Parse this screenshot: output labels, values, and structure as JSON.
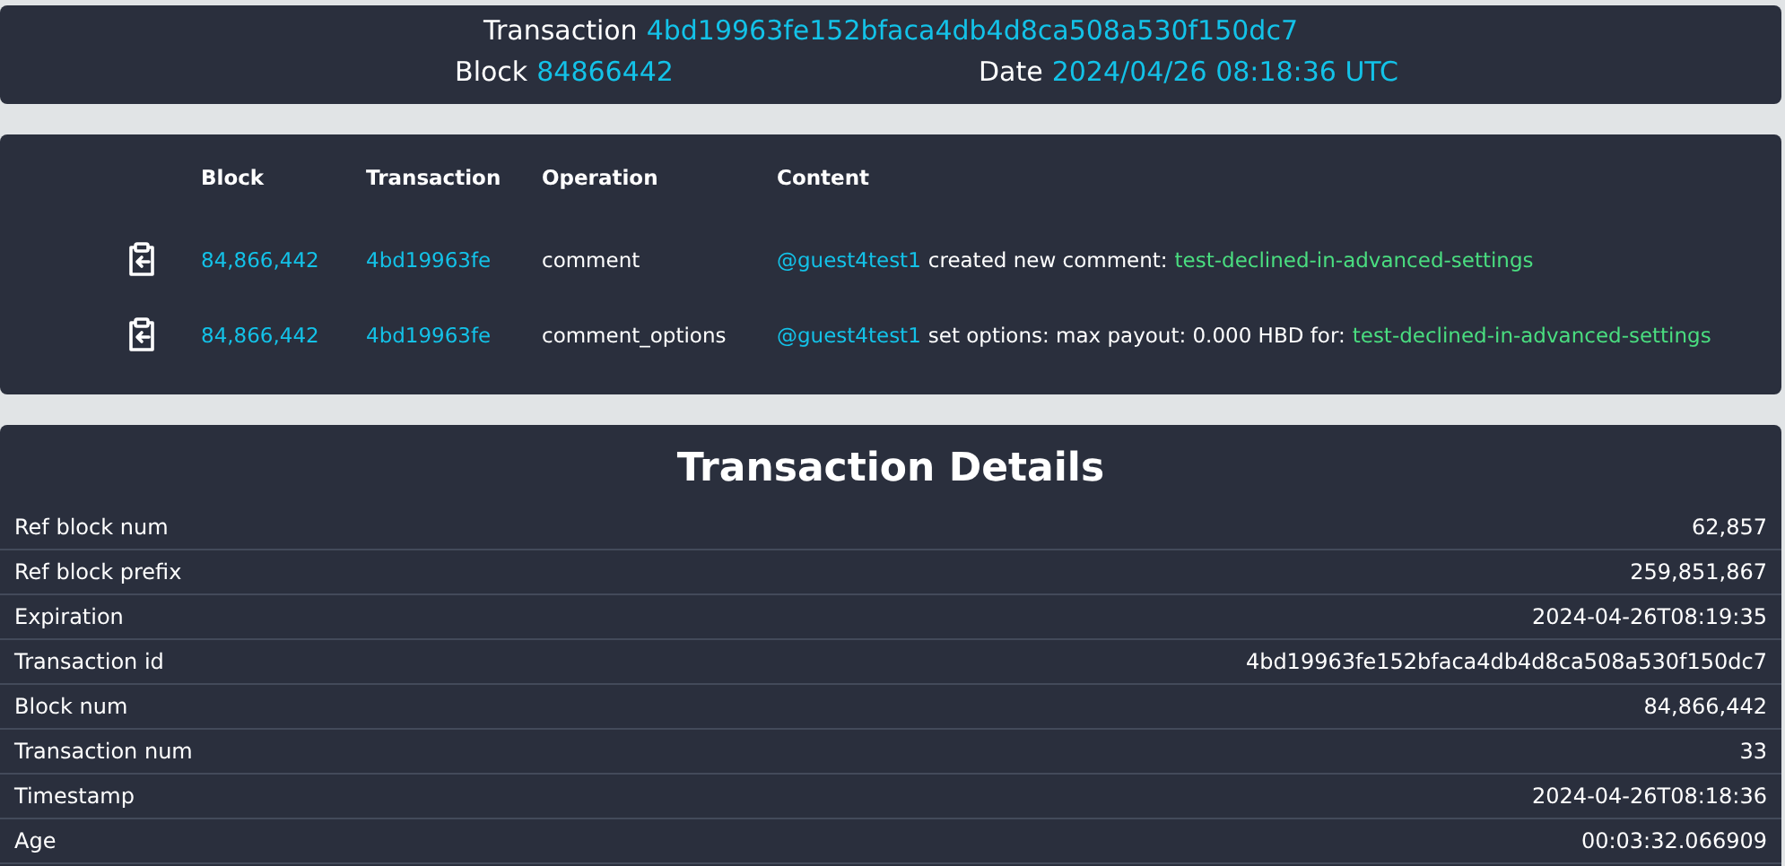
{
  "header": {
    "transaction_label": "Transaction",
    "transaction_id": "4bd19963fe152bfaca4db4d8ca508a530f150dc7",
    "block_label": "Block",
    "block": "84866442",
    "date_label": "Date",
    "date": "2024/04/26 08:18:36 UTC"
  },
  "operations": {
    "columns": [
      "Block",
      "Transaction",
      "Operation",
      "Content"
    ],
    "rows": [
      {
        "block": "84,866,442",
        "transaction": "4bd19963fe",
        "operation": "comment",
        "account": "@guest4test1",
        "text": "created new comment:",
        "permlink": "test-declined-in-advanced-settings"
      },
      {
        "block": "84,866,442",
        "transaction": "4bd19963fe",
        "operation": "comment_options",
        "account": "@guest4test1",
        "text": "set options: max payout: 0.000 HBD for:",
        "permlink": "test-declined-in-advanced-settings"
      }
    ]
  },
  "details": {
    "title": "Transaction Details",
    "rows": [
      {
        "label": "Ref block num",
        "value": "62,857"
      },
      {
        "label": "Ref block prefix",
        "value": "259,851,867"
      },
      {
        "label": "Expiration",
        "value": "2024-04-26T08:19:35"
      },
      {
        "label": "Transaction id",
        "value": "4bd19963fe152bfaca4db4d8ca508a530f150dc7"
      },
      {
        "label": "Block num",
        "value": "84,866,442"
      },
      {
        "label": "Transaction num",
        "value": "33"
      },
      {
        "label": "Timestamp",
        "value": "2024-04-26T08:18:36"
      },
      {
        "label": "Age",
        "value": "00:03:32.066909"
      }
    ]
  }
}
